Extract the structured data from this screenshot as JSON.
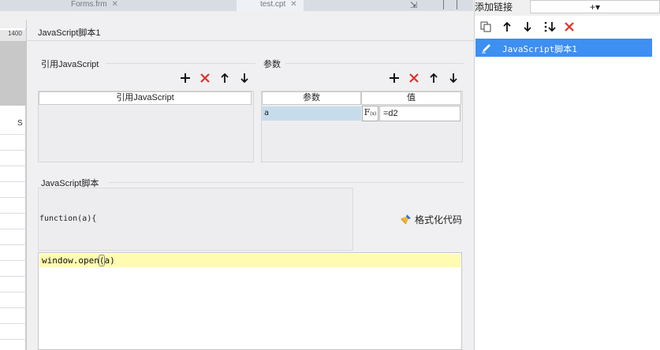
{
  "background": {
    "tab1": "Forms.frm",
    "tab2": "test.cpt",
    "ruler_label": "1400",
    "column_label": "S"
  },
  "dialog": {
    "title": "JavaScript脚本1",
    "imports": {
      "section_title": "引用JavaScript",
      "column_header": "引用JavaScript"
    },
    "params": {
      "section_title": "参数",
      "col_name": "参数",
      "col_value": "值",
      "rows": [
        {
          "name": "a",
          "fx_label": "F",
          "fx_sub": "(x)",
          "value": "=d2"
        }
      ]
    },
    "script": {
      "section_title": "JavaScript脚本",
      "signature": "function(a){",
      "format_label": "格式化代码",
      "code_before": "window.open",
      "code_paren": "(",
      "code_after": "a)"
    }
  },
  "right_panel": {
    "header_label": "添加链接",
    "add_symbol": "+▾",
    "items": [
      {
        "label": "JavaScript脚本1",
        "selected": true
      }
    ]
  },
  "colors": {
    "selection": "#3d8ff1",
    "delete_red": "#e0302b",
    "editor_highlight": "#fffbb0"
  }
}
